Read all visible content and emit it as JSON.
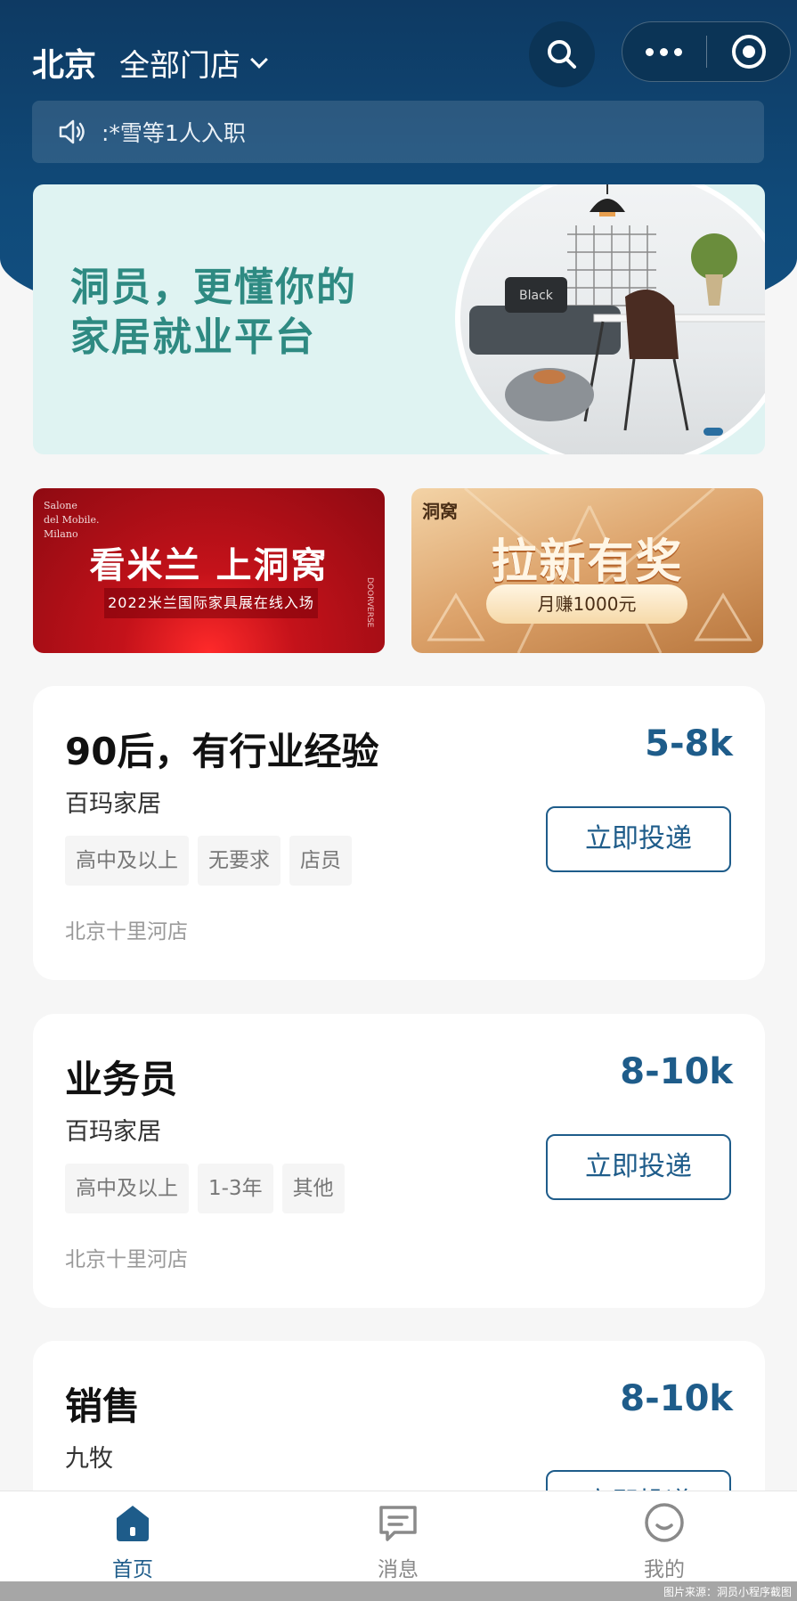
{
  "header": {
    "city": "北京",
    "store_filter": "全部门店",
    "notice": ":*雪等1人入职"
  },
  "banner": {
    "title": "洞员，更懂你的\n家居就业平台",
    "photo_text": "Black"
  },
  "promos": {
    "left": {
      "corner": "Salone\ndel Mobile.\nMilano",
      "main": "看米兰 上洞窝",
      "sub": "2022米兰国际家具展在线入场",
      "vertical": "DOORVERSE"
    },
    "right": {
      "brand": "洞窝",
      "main": "拉新有奖",
      "pill": "月赚1000元"
    }
  },
  "jobs": [
    {
      "title": "90后，有行业经验",
      "salary": "5-8k",
      "company": "百玛家居",
      "tags": [
        "高中及以上",
        "无要求",
        "店员"
      ],
      "location": "北京十里河店",
      "apply_label": "立即投递"
    },
    {
      "title": "业务员",
      "salary": "8-10k",
      "company": "百玛家居",
      "tags": [
        "高中及以上",
        "1-3年",
        "其他"
      ],
      "location": "北京十里河店",
      "apply_label": "立即投递"
    },
    {
      "title": "销售",
      "salary": "8-10k",
      "company": "九牧",
      "tags": [],
      "location": "",
      "apply_label": "立即投递"
    }
  ],
  "tabbar": {
    "home": "首页",
    "messages": "消息",
    "me": "我的"
  },
  "footer": {
    "source": "图片来源：洞员小程序截图"
  },
  "colors": {
    "brand": "#1e5c8a",
    "header": "#0e3a63",
    "banner_text": "#2e8a82"
  }
}
